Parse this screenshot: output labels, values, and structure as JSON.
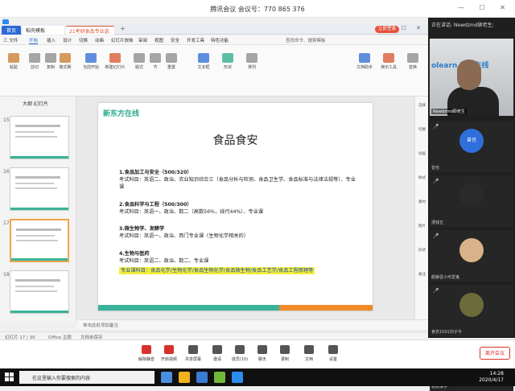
{
  "meeting": {
    "title": "腾讯会议  会议号：770 865 376",
    "window_controls": "—  ☐  ✕"
  },
  "wps": {
    "tabs": {
      "home": "首页",
      "templates": "稻壳模板",
      "doc": "21考研食品专业选题.pptx",
      "add": "+"
    },
    "login": "立即登录",
    "window_controls": "—  ☐  ✕",
    "menu": [
      "三 文件",
      "开始",
      "插入",
      "设计",
      "切换",
      "动画",
      "幻灯片放映",
      "审阅",
      "视图",
      "安全",
      "开发工具",
      "特色功能"
    ],
    "menu_active": 1,
    "search_label": "查找命令、搜索模板",
    "ribbon": [
      "粘贴",
      "剪切",
      "复制",
      "格式刷",
      "当前开始",
      "新建幻灯片",
      "版式",
      "节",
      "重置",
      "文本框",
      "形状",
      "排列",
      "文档助手",
      "演示工具",
      "替换"
    ]
  },
  "panel": {
    "tabs": "大纲  幻灯片",
    "slide_numbers": [
      "15",
      "16",
      "17",
      "18"
    ],
    "selected": "17"
  },
  "slide": {
    "logo": "新东方在线",
    "title": "食品食安",
    "sections": [
      {
        "head": "1.食品加工与安全（500/320）",
        "body": "考试科目：英语二、政治、农业知识综合三（食品分析与检测、食品卫生学、食品标准与法律法规等）、专业课"
      },
      {
        "head": "2.食品科学与工程（500/300）",
        "body": "考试科目：英语一、政治、数二（高数56%，线代44%）、专业课"
      },
      {
        "head": "3.微生物学、发酵学",
        "body": "考试科目：英语一、政治、西门专业课（生物化学相关的）"
      },
      {
        "head": "4.生物与医药",
        "body": "考试科目：英语二、政治、数二、专业课"
      }
    ],
    "highlight": "专业课科目：食品化学/生物化学/食品生物化学/食品微生物/食品工艺学/食品工程原理等"
  },
  "notes": "单击此处添加备注",
  "status": {
    "slide_pos": "幻灯片 17 / 30",
    "theme": "Office 主题",
    "recover": "文档未保存"
  },
  "rail": [
    "选择",
    "切换",
    "动画",
    "样式",
    "素材",
    "图片",
    "形状",
    "备注"
  ],
  "right_panel": {
    "speaker": "正在讲话: Newdzmd顾老生;",
    "main_name": "Newdzmd顾老生",
    "main_brand": "olearn 东方在线",
    "participants": [
      {
        "name": "曾也",
        "avatar_color": "#2f6fdc",
        "avatar_text": "曾也"
      },
      {
        "name": "漫钱五",
        "avatar_color": "#2a2a2a",
        "avatar_text": ""
      },
      {
        "name": "颜静昏小可爱鬼",
        "avatar_color": "#d8b38a",
        "avatar_text": ""
      },
      {
        "name": "食农1501刘子今",
        "avatar_color": "#6b6b3a",
        "avatar_text": ""
      },
      {
        "name": "谢颖琳子",
        "avatar_color": "#5a7fa8",
        "avatar_text": ""
      }
    ]
  },
  "controls": [
    {
      "label": "解除静音",
      "color": "red"
    },
    {
      "label": "开启视频",
      "color": "red"
    },
    {
      "label": "共享屏幕",
      "color": "dark"
    },
    {
      "label": "邀请",
      "color": "dark"
    },
    {
      "label": "成员(10)",
      "color": "dark"
    },
    {
      "label": "聊天",
      "color": "dark"
    },
    {
      "label": "录制",
      "color": "dark"
    },
    {
      "label": "文档",
      "color": "dark"
    },
    {
      "label": "设置",
      "color": "dark"
    }
  ],
  "end_meeting": "离开会议",
  "taskbar": {
    "search_placeholder": "在这里输入你要搜索的内容",
    "time": "14:28",
    "date": "2020/4/17"
  }
}
